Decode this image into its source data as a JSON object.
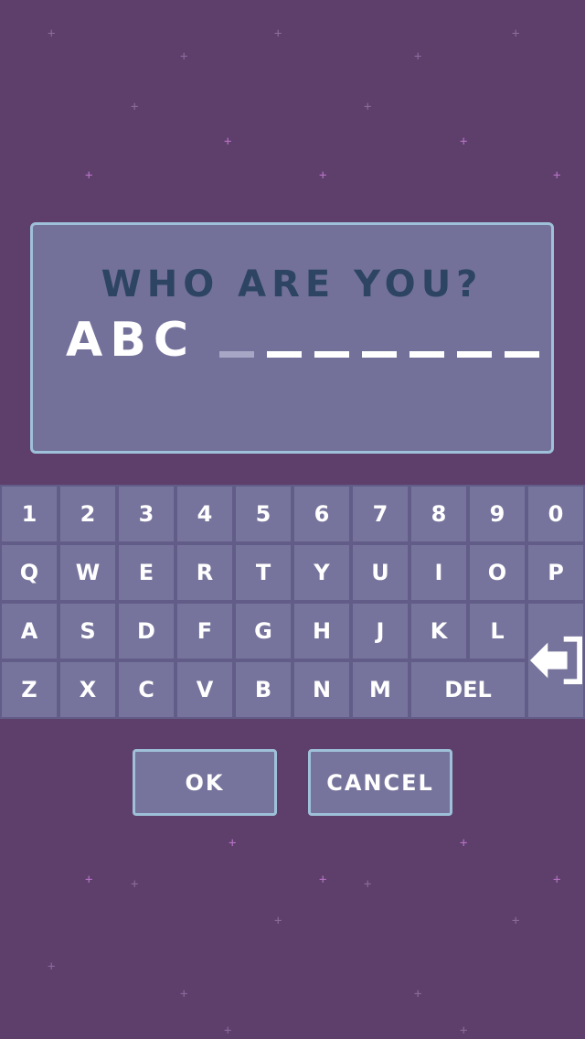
{
  "dialog": {
    "prompt": "WHO ARE YOU?",
    "typed": "ABC",
    "max_length": 10
  },
  "keyboard": {
    "rows": [
      [
        "1",
        "2",
        "3",
        "4",
        "5",
        "6",
        "7",
        "8",
        "9",
        "0"
      ],
      [
        "Q",
        "W",
        "E",
        "R",
        "T",
        "Y",
        "U",
        "I",
        "O",
        "P"
      ],
      [
        "A",
        "S",
        "D",
        "F",
        "G",
        "H",
        "J",
        "K",
        "L"
      ],
      [
        "Z",
        "X",
        "C",
        "V",
        "B",
        "N",
        "M"
      ]
    ],
    "delete_label": "DEL",
    "enter_icon": "enter-arrow-icon"
  },
  "buttons": {
    "ok_label": "OK",
    "cancel_label": "CANCEL"
  },
  "colors": {
    "background": "#5e3f6c",
    "panel": "#73719a",
    "panel_border": "#9ec0d8",
    "prompt_text": "#2d4562",
    "key": "#76749c"
  }
}
